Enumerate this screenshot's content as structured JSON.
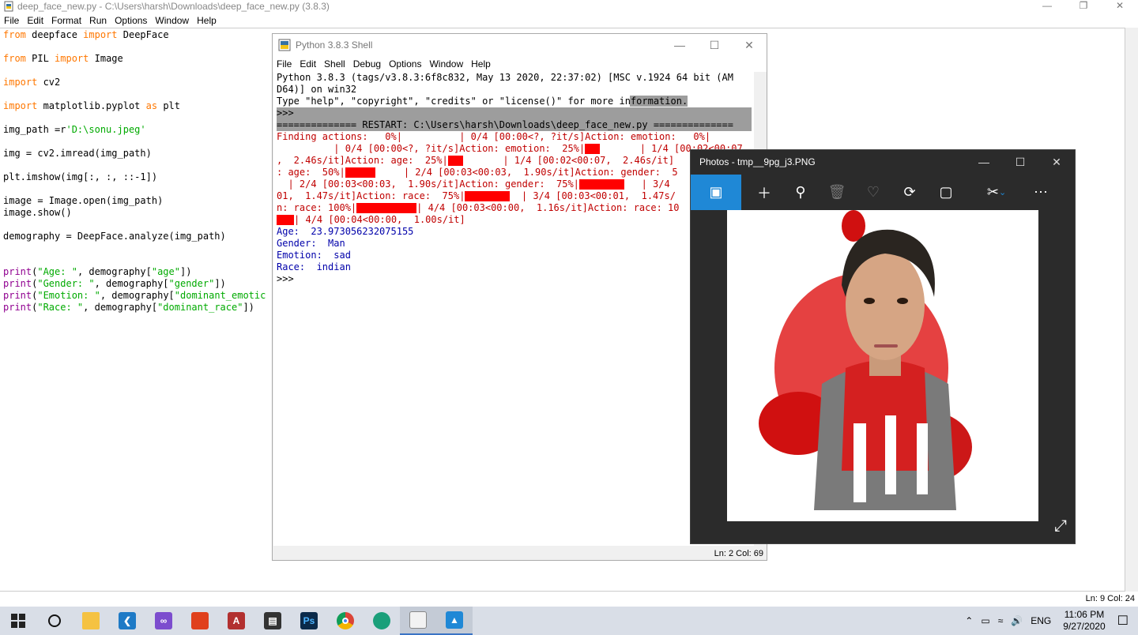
{
  "editor": {
    "title": "deep_face_new.py - C:\\Users\\harsh\\Downloads\\deep_face_new.py (3.8.3)",
    "menu": [
      "File",
      "Edit",
      "Format",
      "Run",
      "Options",
      "Window",
      "Help"
    ],
    "status": "Ln: 9   Col: 24",
    "code": {
      "l1": [
        "from",
        " deepface ",
        "import",
        " DeepFace"
      ],
      "l2": [
        "from",
        " PIL ",
        "import",
        " Image"
      ],
      "l3": [
        "import",
        " cv2"
      ],
      "l4": [
        "import",
        " matplotlib.pyplot ",
        "as",
        " plt"
      ],
      "l5": [
        "img_path =r",
        "'D:\\sonu.jpeg'"
      ],
      "l6": "img = cv2.imread(img_path)",
      "l7": "plt.imshow(img[:, :, ::-1])",
      "l8": "image = Image.open(img_path)",
      "l9": "image.show()",
      "l10": "demography = DeepFace.analyze(img_path)",
      "l11": [
        "print",
        "(",
        "\"Age: \"",
        ", demography[",
        "\"age\"",
        "])"
      ],
      "l12": [
        "print",
        "(",
        "\"Gender: \"",
        ", demography[",
        "\"gender\"",
        "])"
      ],
      "l13": [
        "print",
        "(",
        "\"Emotion: \"",
        ", demography[",
        "\"dominant_emotic"
      ],
      "l14": [
        "print",
        "(",
        "\"Race: \"",
        ", demography[",
        "\"dominant_race\"",
        "])"
      ]
    }
  },
  "shell": {
    "title": "Python 3.8.3 Shell",
    "menu": [
      "File",
      "Edit",
      "Shell",
      "Debug",
      "Options",
      "Window",
      "Help"
    ],
    "status": "Ln: 2   Col: 69",
    "header1": "Python 3.8.3 (tags/v3.8.3:6f8c832, May 13 2020, 22:37:02) [MSC v.1924 64 bit (AM",
    "header2": "D64)] on win32",
    "header3": "Type \"help\", \"copyright\", \"credits\" or \"license()\" for more information.",
    "prompt": ">>> ",
    "restart": "============== RESTART: C:\\Users\\harsh\\Downloads\\deep_face_new.py ==============",
    "err1": "Finding actions:   0%|          | 0/4 [00:00<?, ?it/s]Action: emotion:   0%|",
    "err2a": "          | 0/4 [00:00<?, ?it/s]Action: emotion:  25%|",
    "err2b": "       | 1/4 [00:02<00:07",
    "err3a": ",  2.46s/it]Action: age:  25%|",
    "err3b": "       | 1/4 [00:02<00:07,  2.46s/it]",
    "err4a": ": age:  50%|",
    "err4b": "     | 2/4 [00:03<00:03,  1.90s/it]Action: gender:  5",
    "err5a": "  | 2/4 [00:03<00:03,  1.90s/it]Action: gender:  75%|",
    "err5b": "   | 3/4",
    "err6a": "01,  1.47s/it]Action: race:  75%|",
    "err6b": "  | 3/4 [00:03<00:01,  1.47s/",
    "err7a": "n: race: 100%|",
    "err7b": "| 4/4 [00:03<00:00,  1.16s/it]Action: race: 10",
    "err8b": "| 4/4 [00:04<00:00,  1.00s/it]",
    "out1": "Age:  23.973056232075155",
    "out2": "Gender:  Man",
    "out3": "Emotion:  sad",
    "out4": "Race:  indian"
  },
  "photos": {
    "title": "Photos - tmp__9pg_j3.PNG"
  },
  "taskbar": {
    "lang": "ENG",
    "time": "11:06 PM",
    "date": "9/27/2020"
  }
}
